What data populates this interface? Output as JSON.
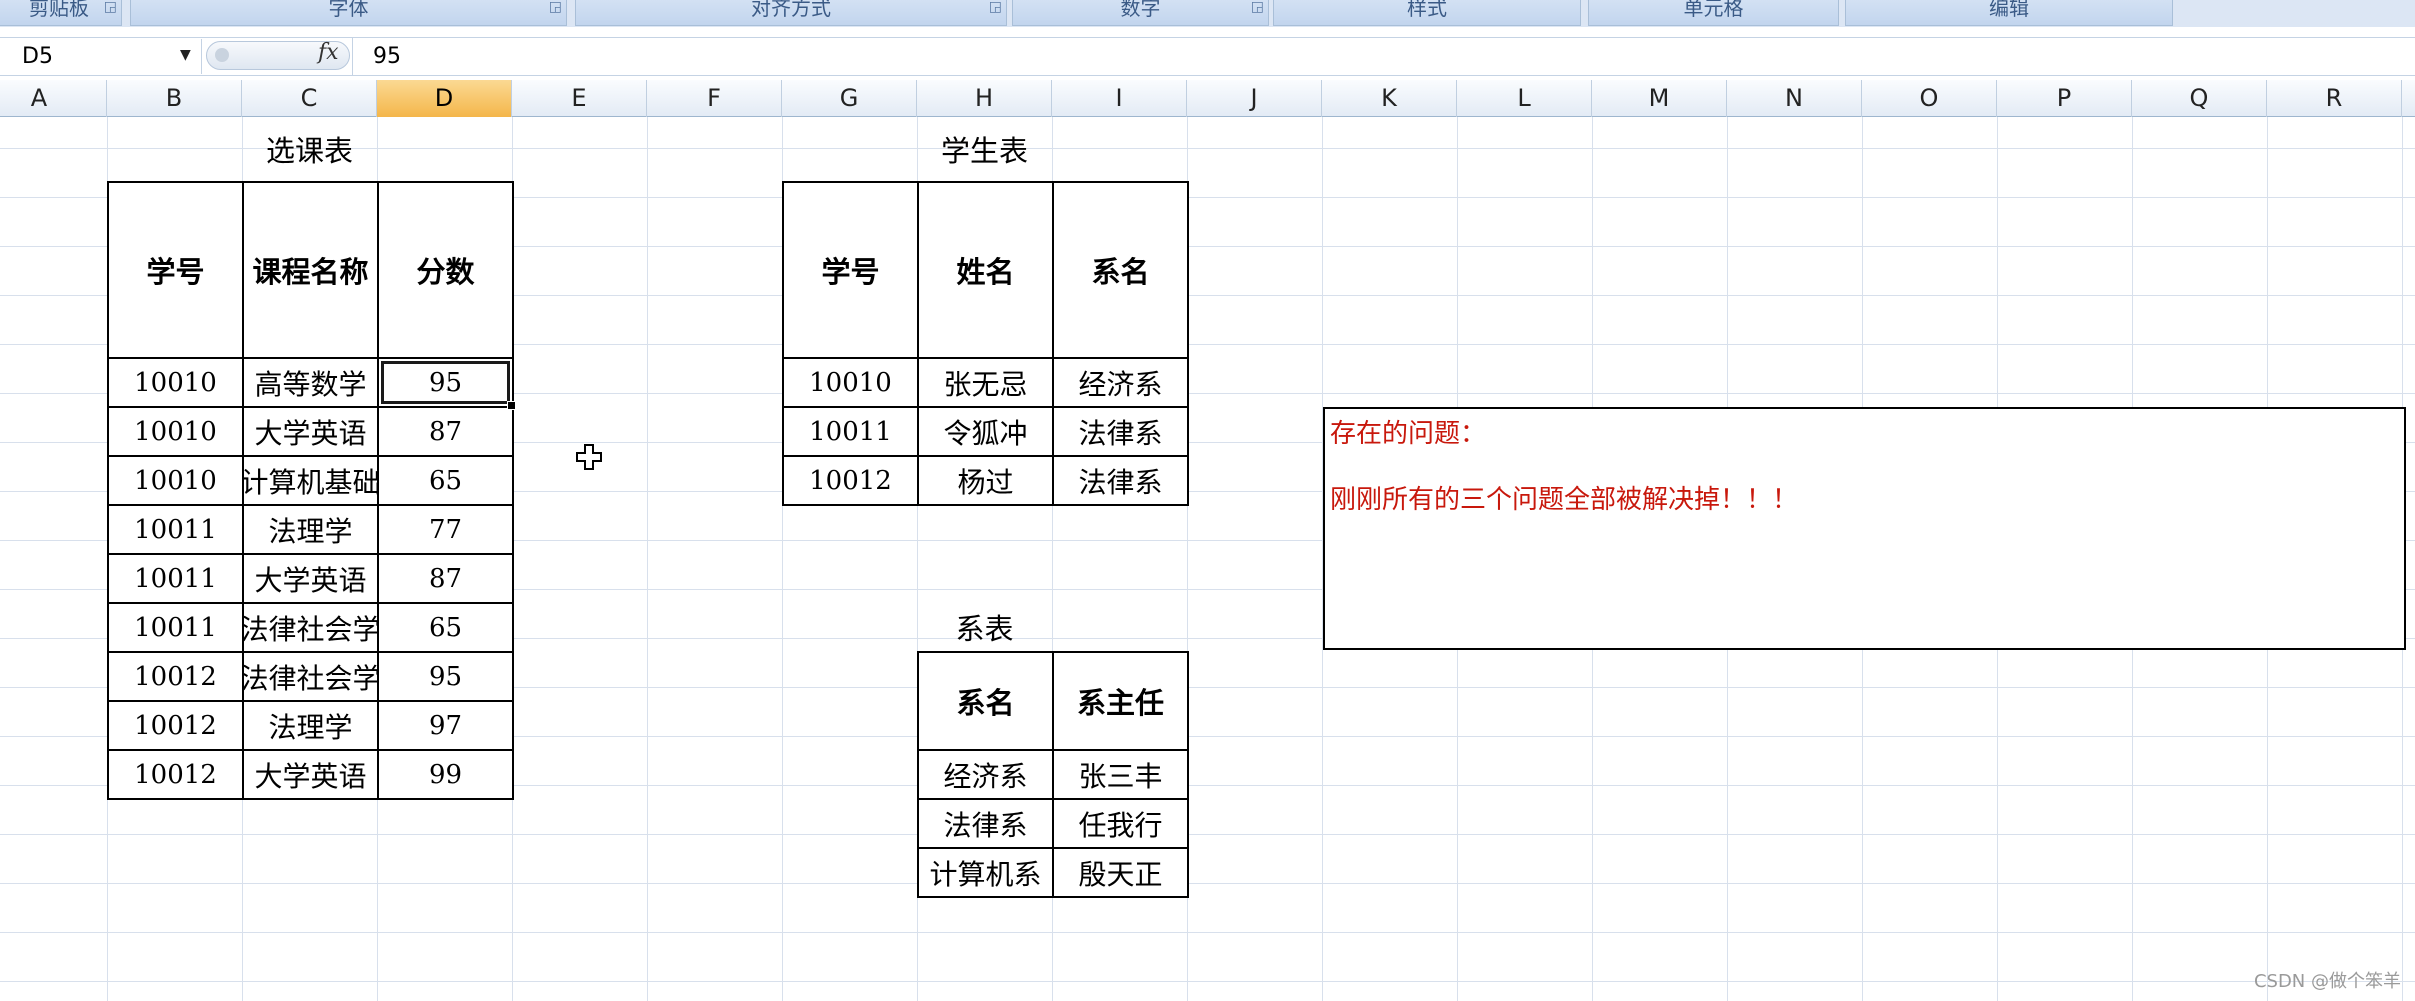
{
  "ribbon": {
    "groups": [
      "剪贴板",
      "字体",
      "对齐方式",
      "数字",
      "样式",
      "单元格",
      "编辑"
    ]
  },
  "formula_bar": {
    "name_box": "D5",
    "fx_label": "fx",
    "value": "95"
  },
  "columns": [
    "A",
    "B",
    "C",
    "D",
    "E",
    "F",
    "G",
    "H",
    "I",
    "J",
    "K",
    "L",
    "M",
    "N",
    "O",
    "P",
    "Q",
    "R"
  ],
  "selected_column": "D",
  "course_table": {
    "title": "选课表",
    "headers": [
      "学号",
      "课程名称",
      "分数"
    ],
    "rows": [
      [
        "10010",
        "高等数学",
        "95"
      ],
      [
        "10010",
        "大学英语",
        "87"
      ],
      [
        "10010",
        "计算机基础",
        "65"
      ],
      [
        "10011",
        "法理学",
        "77"
      ],
      [
        "10011",
        "大学英语",
        "87"
      ],
      [
        "10011",
        "法律社会学",
        "65"
      ],
      [
        "10012",
        "法律社会学",
        "95"
      ],
      [
        "10012",
        "法理学",
        "97"
      ],
      [
        "10012",
        "大学英语",
        "99"
      ]
    ]
  },
  "student_table": {
    "title": "学生表",
    "headers": [
      "学号",
      "姓名",
      "系名"
    ],
    "rows": [
      [
        "10010",
        "张无忌",
        "经济系"
      ],
      [
        "10011",
        "令狐冲",
        "法律系"
      ],
      [
        "10012",
        "杨过",
        "法律系"
      ]
    ]
  },
  "dept_table": {
    "title": "系表",
    "headers": [
      "系名",
      "系主任"
    ],
    "rows": [
      [
        "经济系",
        "张三丰"
      ],
      [
        "法律系",
        "任我行"
      ],
      [
        "计算机系",
        "殷天正"
      ]
    ]
  },
  "note": {
    "line1": "存在的问题：",
    "line2": "刚刚所有的三个问题全部被解决掉！！！"
  },
  "watermark": "CSDN @做个笨羊",
  "colors": {
    "note_text": "#c8180c",
    "selected_header": "#f4b64a"
  }
}
